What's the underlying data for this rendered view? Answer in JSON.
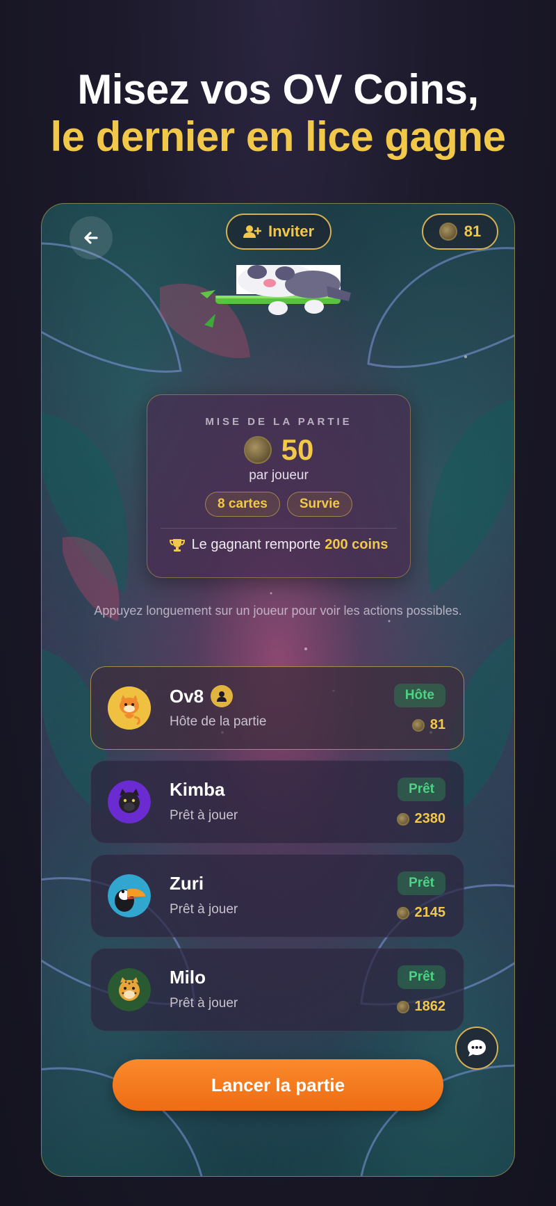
{
  "headline": {
    "line1": "Misez vos OV Coins,",
    "line2": "le dernier en lice gagne"
  },
  "colors": {
    "gold": "#f2c84b",
    "green": "#4bd482",
    "orange": "#f47a1f"
  },
  "topbar": {
    "back_icon": "arrow-left-icon",
    "invite_label": "Inviter",
    "invite_icon": "user-plus-icon",
    "coin_balance": "81"
  },
  "stake": {
    "label": "MISE DE LA PARTIE",
    "amount": "50",
    "per_player": "par joueur",
    "chips": [
      "8 cartes",
      "Survie"
    ],
    "win_prefix": "Le gagnant remporte",
    "win_amount": "200 coins"
  },
  "hint": "Appuyez longuement sur un joueur pour voir les actions possibles.",
  "players": [
    {
      "name": "Ov8",
      "status": "Hôte de la partie",
      "badge": "Hôte",
      "coins": "81",
      "avatar": "tiger"
    },
    {
      "name": "Kimba",
      "status": "Prêt à jouer",
      "badge": "Prêt",
      "coins": "2380",
      "avatar": "panther"
    },
    {
      "name": "Zuri",
      "status": "Prêt à jouer",
      "badge": "Prêt",
      "coins": "2145",
      "avatar": "toucan"
    },
    {
      "name": "Milo",
      "status": "Prêt à jouer",
      "badge": "Prêt",
      "coins": "1862",
      "avatar": "leopard"
    }
  ],
  "cta": "Lancer la partie"
}
